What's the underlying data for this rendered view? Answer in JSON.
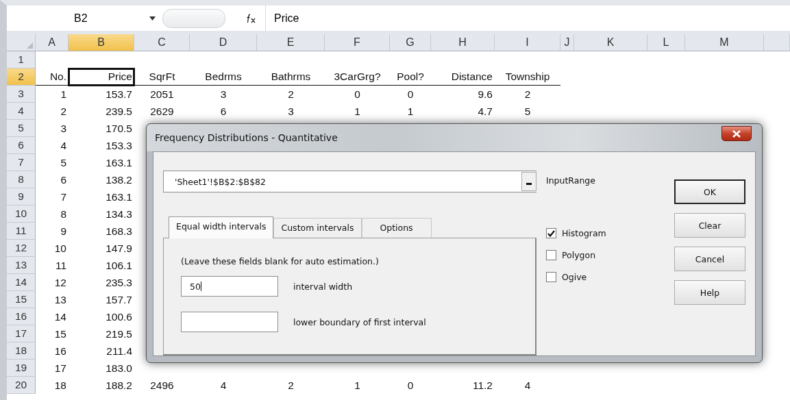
{
  "formula_bar": {
    "name_box": "B2",
    "formula": "Price"
  },
  "sheet": {
    "columns": [
      {
        "letter": "A",
        "selected": false
      },
      {
        "letter": "B",
        "selected": true
      },
      {
        "letter": "C",
        "selected": false
      },
      {
        "letter": "D",
        "selected": false
      },
      {
        "letter": "E",
        "selected": false
      },
      {
        "letter": "F",
        "selected": false
      },
      {
        "letter": "G",
        "selected": false
      },
      {
        "letter": "H",
        "selected": false
      },
      {
        "letter": "I",
        "selected": false
      },
      {
        "letter": "J",
        "selected": false
      },
      {
        "letter": "K",
        "selected": false
      },
      {
        "letter": "L",
        "selected": false
      },
      {
        "letter": "M",
        "selected": false
      }
    ],
    "rows": [
      {
        "number": "1",
        "selected": false,
        "kind": "data"
      },
      {
        "number": "2",
        "selected": true,
        "kind": "header",
        "cells": [
          "No.",
          "Price",
          "SqrFt",
          "Bedrms",
          "Bathrms",
          "3CarGrg?",
          "Pool?",
          "Distance",
          "Township"
        ]
      },
      {
        "number": "3",
        "selected": false,
        "kind": "data",
        "cells": [
          "1",
          "153.7",
          "2051",
          "3",
          "2",
          "0",
          "0",
          "9.6",
          "2"
        ]
      },
      {
        "number": "4",
        "selected": false,
        "kind": "data",
        "cells": [
          "2",
          "239.5",
          "2629",
          "6",
          "3",
          "1",
          "1",
          "4.7",
          "5"
        ]
      },
      {
        "number": "5",
        "selected": false,
        "kind": "data",
        "cells": [
          "3",
          "170.5"
        ]
      },
      {
        "number": "6",
        "selected": false,
        "kind": "data",
        "cells": [
          "4",
          "153.3"
        ]
      },
      {
        "number": "7",
        "selected": false,
        "kind": "data",
        "cells": [
          "5",
          "163.1"
        ]
      },
      {
        "number": "8",
        "selected": false,
        "kind": "data",
        "cells": [
          "6",
          "138.2"
        ]
      },
      {
        "number": "9",
        "selected": false,
        "kind": "data",
        "cells": [
          "7",
          "163.1"
        ]
      },
      {
        "number": "10",
        "selected": false,
        "kind": "data",
        "cells": [
          "8",
          "134.3"
        ]
      },
      {
        "number": "11",
        "selected": false,
        "kind": "data",
        "cells": [
          "9",
          "168.3"
        ]
      },
      {
        "number": "12",
        "selected": false,
        "kind": "data",
        "cells": [
          "10",
          "147.9"
        ]
      },
      {
        "number": "13",
        "selected": false,
        "kind": "data",
        "cells": [
          "11",
          "106.1"
        ]
      },
      {
        "number": "14",
        "selected": false,
        "kind": "data",
        "cells": [
          "12",
          "235.3"
        ]
      },
      {
        "number": "15",
        "selected": false,
        "kind": "data",
        "cells": [
          "13",
          "157.7"
        ]
      },
      {
        "number": "16",
        "selected": false,
        "kind": "data",
        "cells": [
          "14",
          "100.6"
        ]
      },
      {
        "number": "17",
        "selected": false,
        "kind": "data",
        "cells": [
          "15",
          "219.5"
        ]
      },
      {
        "number": "18",
        "selected": false,
        "kind": "data",
        "cells": [
          "16",
          "211.4"
        ]
      },
      {
        "number": "19",
        "selected": false,
        "kind": "data",
        "cells": [
          "17",
          "183.0"
        ]
      },
      {
        "number": "20",
        "selected": false,
        "kind": "data",
        "cells": [
          "18",
          "188.2",
          "2496",
          "4",
          "2",
          "1",
          "0",
          "11.2",
          "4"
        ]
      }
    ]
  },
  "dialog": {
    "title": "Frequency Distributions - Quantitative",
    "input_range": {
      "value": "'Sheet1'!$B$2:$B$82",
      "label": "InputRange"
    },
    "tabs": [
      {
        "label": "Equal width intervals",
        "selected": true
      },
      {
        "label": "Custom intervals",
        "selected": false
      },
      {
        "label": "Options",
        "selected": false
      }
    ],
    "hint": "(Leave these fields  blank for auto estimation.)",
    "fields": [
      {
        "value": "50",
        "label": "interval width"
      },
      {
        "label": "lower boundary of first interval"
      }
    ],
    "checkboxes": [
      {
        "label": "Histogram",
        "checked": true
      },
      {
        "label": "Polygon",
        "checked": false
      },
      {
        "label": "Ogive",
        "checked": false
      }
    ],
    "buttons": [
      {
        "label": "OK",
        "default": true
      },
      {
        "label": "Clear",
        "default": false
      },
      {
        "label": "Cancel",
        "default": false
      },
      {
        "label": "Help",
        "default": false
      }
    ]
  }
}
